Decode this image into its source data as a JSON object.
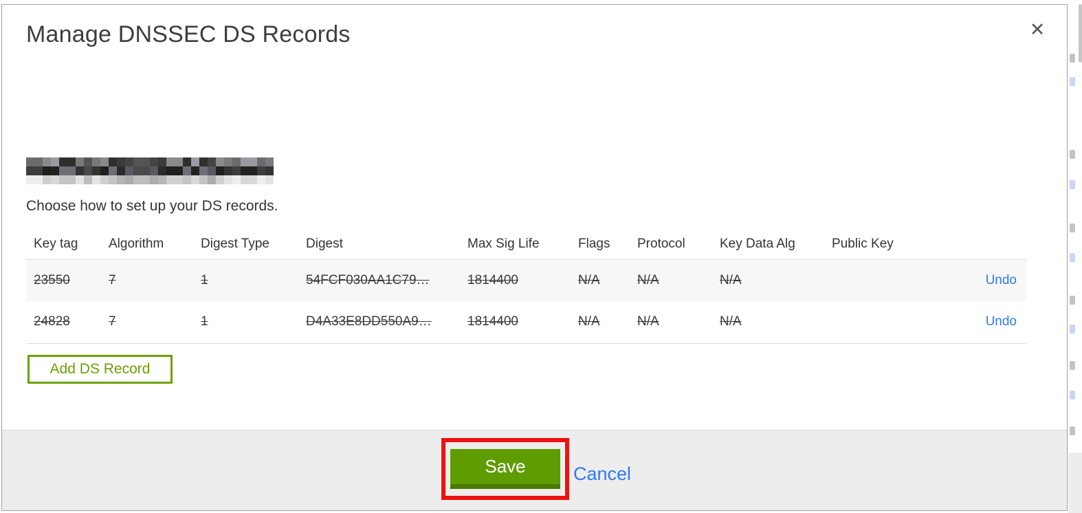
{
  "modal": {
    "title": "Manage DNSSEC DS Records",
    "close_label": "✕",
    "intro": "Choose how to set up your DS records.",
    "table": {
      "headers": [
        "Key tag",
        "Algorithm",
        "Digest Type",
        "Digest",
        "Max Sig Life",
        "Flags",
        "Protocol",
        "Key Data Alg",
        "Public Key"
      ],
      "rows": [
        {
          "key_tag": "23550",
          "algorithm": "7",
          "digest_type": "1",
          "digest": "54FCF030AA1C79…",
          "max_sig_life": "1814400",
          "flags": "N/A",
          "protocol": "N/A",
          "key_data_alg": "N/A",
          "public_key": "",
          "action": "Undo"
        },
        {
          "key_tag": "24828",
          "algorithm": "7",
          "digest_type": "1",
          "digest": "D4A33E8DD550A9…",
          "max_sig_life": "1814400",
          "flags": "N/A",
          "protocol": "N/A",
          "key_data_alg": "N/A",
          "public_key": "",
          "action": "Undo"
        }
      ]
    },
    "add_button_label": "Add DS Record",
    "footer": {
      "save_label": "Save",
      "cancel_label": "Cancel"
    }
  },
  "colors": {
    "accent_green": "#5f9c02",
    "outline_green": "#6ba100",
    "link_blue": "#2e7af2",
    "annotation_red": "#ee1111",
    "footer_gray": "#ededed",
    "row_stripe": "#f7f7f7"
  }
}
